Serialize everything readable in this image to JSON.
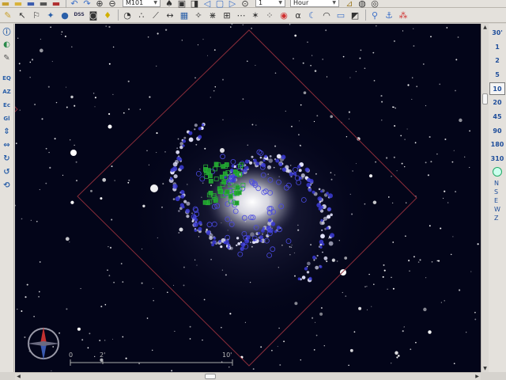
{
  "toolbar_top": {
    "object_field": "M101",
    "time_unit": "Hour",
    "step_value": "1"
  },
  "toolbar_main": {
    "dss_label": "DSS"
  },
  "left_tools": {
    "eq_label": "EQ",
    "az_label": "AZ",
    "ec_label": "Ec",
    "gl_label": "Gl"
  },
  "fov_buttons": [
    "30'",
    "1",
    "2",
    "5",
    "10",
    "20",
    "45",
    "90",
    "180",
    "310"
  ],
  "fov_selected": "10",
  "direction_buttons": [
    "N",
    "S",
    "E",
    "W",
    "Z"
  ],
  "scale_ruler": {
    "labels": [
      "0",
      "2'",
      "10'"
    ]
  },
  "colors": {
    "sky_background": "#030519",
    "fov_frame": "#8a2d3a",
    "hii_region_markers": "#3b3bd6",
    "cluster_markers": "#1f9a2e",
    "toolbar_blue": "#1e4d9a"
  }
}
